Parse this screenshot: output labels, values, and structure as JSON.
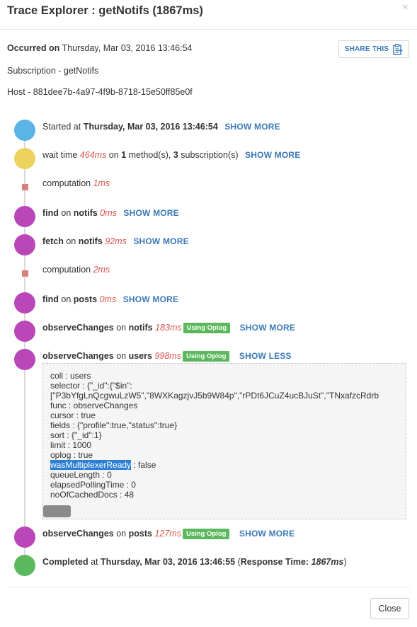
{
  "header": {
    "title": "Trace Explorer : getNotifs (1867ms)",
    "close_glyph": "×"
  },
  "info": {
    "occurred_label": "Occurred on",
    "occurred_value": "Thursday, Mar 03, 2016 13:46:54",
    "subscription": "Subscription - getNotifs",
    "host": "Host - 881dee7b-4a97-4f9b-8718-15e50ff85e0f"
  },
  "share": {
    "label": "SHARE THIS",
    "icon": "clipboard-icon"
  },
  "colors": {
    "started": "#5ab4e6",
    "wait": "#ecd25e",
    "purple": "#b947b8",
    "computation": "#d9807a",
    "completed": "#5cb85c",
    "link": "#3a7ab8",
    "time": "#d9534f",
    "oplog_badge": "#5cb85c"
  },
  "timeline": {
    "started": {
      "pre": "Started at ",
      "date": "Thursday, Mar 03, 2016 13:46:54",
      "more": "SHOW MORE"
    },
    "wait": {
      "pre": "wait time ",
      "time": "464ms",
      "on": " on ",
      "methods_count": "1",
      "methods_label": " method(s), ",
      "subs_count": "3",
      "subs_label": " subscription(s)",
      "more": "SHOW MORE"
    },
    "computation1": {
      "label": "computation ",
      "time": "1ms"
    },
    "find_notifs": {
      "op": "find",
      "on": " on ",
      "coll": "notifs",
      "time": "0ms",
      "more": "SHOW MORE"
    },
    "fetch_notifs": {
      "op": "fetch",
      "on": " on ",
      "coll": "notifs",
      "time": "92ms",
      "more": "SHOW MORE"
    },
    "computation2": {
      "label": "computation ",
      "time": "2ms"
    },
    "find_posts": {
      "op": "find",
      "on": " on ",
      "coll": "posts",
      "time": "0ms",
      "more": "SHOW MORE"
    },
    "observe_notifs": {
      "op": "observeChanges",
      "on": " on ",
      "coll": "notifs",
      "time": "183ms",
      "badge": "Using Oplog",
      "more": "SHOW MORE"
    },
    "observe_users": {
      "op": "observeChanges",
      "on": " on ",
      "coll": "users",
      "time": "998ms",
      "badge": "Using Oplog",
      "more": "SHOW LESS"
    },
    "observe_posts": {
      "op": "observeChanges",
      "on": " on ",
      "coll": "posts",
      "time": "127ms",
      "badge": "Using Oplog",
      "more": "SHOW MORE"
    },
    "completed": {
      "pre": "Completed",
      "at": " at ",
      "date": "Thursday, Mar 03, 2016 13:46:55",
      "open": " (",
      "resp_label": "Response Time: ",
      "resp_value": "1867ms",
      "close": ")"
    }
  },
  "details": {
    "coll": "coll : users",
    "selector1": "selector : {\"_id\":{\"$in\":",
    "selector2": "[\"P3bYfgLnQcgwuLzW5\",\"8WXKagzjvJ5b9W84p\",\"rPDt6JCuZ4ucBJuSt\",\"TNxafzcRdrb",
    "func": "func : observeChanges",
    "cursor": "cursor : true",
    "fields": "fields : {\"profile\":true,\"status\":true}",
    "sort": "sort : {\"_id\":1}",
    "limit": "limit : 1000",
    "oplog": "oplog : true",
    "was_key": "wasMultiplexerReady",
    "was_val": " : false",
    "queue": "queueLength : 0",
    "elapsed": "elapsedPollingTime : 0",
    "cached": "noOfCachedDocs : 48"
  },
  "footer": {
    "close_label": "Close"
  }
}
